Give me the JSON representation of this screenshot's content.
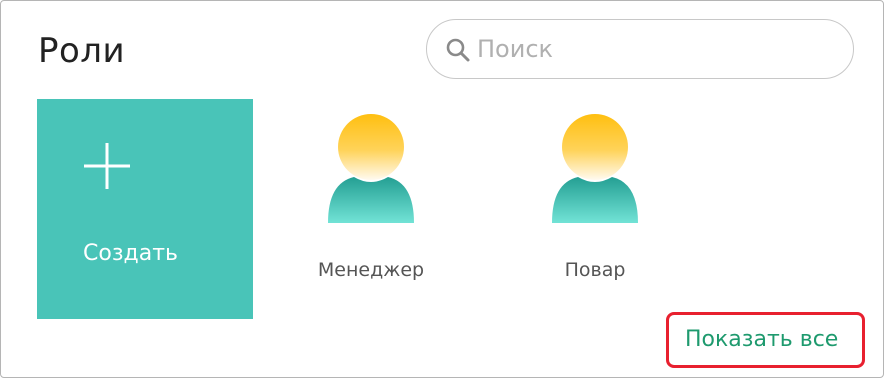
{
  "header": {
    "title": "Роли"
  },
  "search": {
    "placeholder": "Поиск",
    "value": ""
  },
  "create_tile": {
    "label": "Создать",
    "icon": "plus-icon",
    "color": "#49c4b8"
  },
  "roles": [
    {
      "name": "Менеджер",
      "icon": "user-avatar-icon"
    },
    {
      "name": "Повар",
      "icon": "user-avatar-icon"
    }
  ],
  "footer": {
    "show_all_label": "Показать все",
    "link_color": "#1e9a6e",
    "highlight_color": "#e8202f"
  },
  "colors": {
    "avatar_head_top": "#ffc21a",
    "avatar_head_bottom": "#fff8e6",
    "avatar_body_top": "#27a99c",
    "avatar_body_bottom": "#6fe0d2"
  }
}
